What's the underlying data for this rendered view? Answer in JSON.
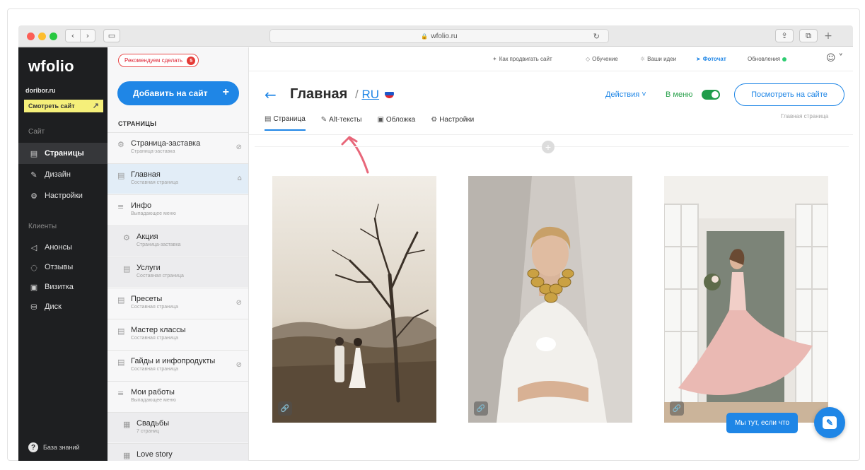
{
  "browser": {
    "url": "wfolio.ru",
    "back_icon": "chevron-left-icon",
    "forward_icon": "chevron-right-icon"
  },
  "sidebar": {
    "logo": "wfolio",
    "site_name": "doribor.ru",
    "view_site_label": "Смотреть сайт",
    "section_site": "Сайт",
    "section_clients": "Клиенты",
    "items": [
      {
        "label": "Страницы",
        "icon": "page-icon",
        "active": true
      },
      {
        "label": "Дизайн",
        "icon": "brush-icon"
      },
      {
        "label": "Настройки",
        "icon": "gear-icon"
      },
      {
        "label": "Анонсы",
        "icon": "megaphone-icon"
      },
      {
        "label": "Отзывы",
        "icon": "reviews-icon"
      },
      {
        "label": "Визитка",
        "icon": "card-icon"
      },
      {
        "label": "Диск",
        "icon": "disk-icon"
      }
    ],
    "help_label": "База знаний"
  },
  "pages_panel": {
    "recommend_label": "Рекомендуем сделать",
    "recommend_count": "5",
    "add_button_label": "Добавить на сайт",
    "heading": "СТРАНИЦЫ",
    "pages": [
      {
        "name": "Страница-заставка",
        "subtitle": "Страница-заставка",
        "icon": "splash-gear-icon",
        "status_icon": "hidden-eye-icon"
      },
      {
        "name": "Главная",
        "subtitle": "Составная страница",
        "icon": "document-icon",
        "status_icon": "home-icon",
        "active": true
      },
      {
        "name": "Инфо",
        "subtitle": "Выпадающее меню",
        "icon": "menu-lines-icon"
      },
      {
        "name": "Акция",
        "subtitle": "Страница-заставка",
        "icon": "splash-gear-icon",
        "nested": true
      },
      {
        "name": "Услуги",
        "subtitle": "Составная страница",
        "icon": "document-icon",
        "nested": true
      },
      {
        "name": "Пресеты",
        "subtitle": "Составная страница",
        "icon": "document-icon",
        "status_icon": "hidden-eye-icon"
      },
      {
        "name": "Мастер классы",
        "subtitle": "Составная страница",
        "icon": "document-icon"
      },
      {
        "name": "Гайды и инфопродукты",
        "subtitle": "Составная страница",
        "icon": "document-icon",
        "status_icon": "hidden-eye-icon"
      },
      {
        "name": "Мои работы",
        "subtitle": "Выпадающее меню",
        "icon": "menu-lines-icon"
      },
      {
        "name": "Свадьбы",
        "subtitle": "7 страниц",
        "icon": "grid-icon",
        "nested": true
      },
      {
        "name": "Love story",
        "subtitle": "",
        "icon": "grid-icon",
        "nested": true
      }
    ]
  },
  "topbar": {
    "links": [
      {
        "label": "Как продвигать сайт",
        "icon": "promo-icon"
      },
      {
        "label": "Обучение",
        "icon": "education-icon"
      },
      {
        "label": "Ваши идеи",
        "icon": "idea-icon"
      },
      {
        "label": "Фоточат",
        "icon": "telegram-icon"
      },
      {
        "label": "Обновления",
        "icon": "updates-icon"
      }
    ]
  },
  "main": {
    "title": "Главная",
    "lang_separator": "/",
    "lang": "RU",
    "actions_label": "Действия",
    "in_menu_label": "В меню",
    "in_menu_enabled": true,
    "view_on_site_label": "Посмотреть на сайте",
    "page_hint": "Главная страница",
    "tabs": [
      {
        "label": "Страница",
        "icon": "page-icon",
        "active": true
      },
      {
        "label": "Alt-тексты",
        "icon": "edit-icon"
      },
      {
        "label": "Обложка",
        "icon": "image-icon"
      },
      {
        "label": "Настройки",
        "icon": "gear-icon"
      }
    ]
  },
  "chat": {
    "tip": "Мы тут, если что",
    "icon": "chat-icon"
  },
  "colors": {
    "accent": "#1f86e6",
    "sidebar_bg": "#1e1f21",
    "highlight": "#f5ef7a",
    "success": "#2aa14c",
    "alert": "#e53935"
  }
}
